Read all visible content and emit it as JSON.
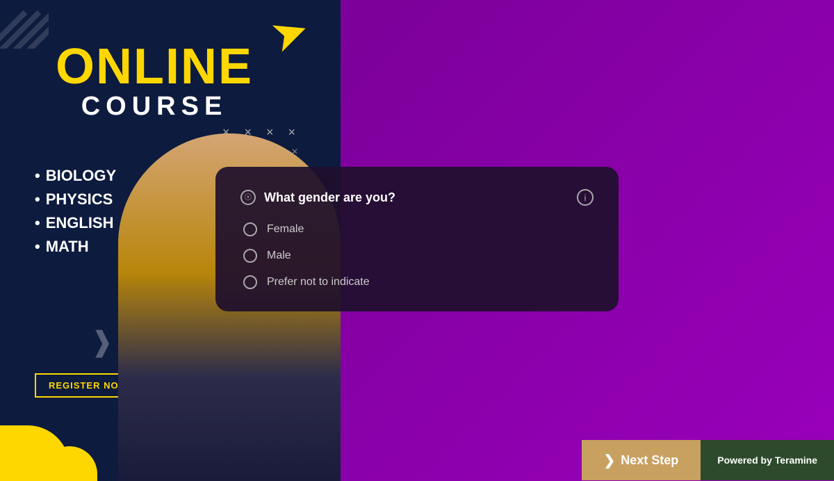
{
  "left_panel": {
    "title_line1": "ONLINE",
    "title_line2": "COURSE",
    "subjects": [
      "BIOLOGY",
      "PHYSICS",
      "ENGLISH",
      "MATH"
    ],
    "register_btn": "REGISTER NOW"
  },
  "x_pattern_1": "× × × ×",
  "x_pattern_2": "× × × ×",
  "question_card": {
    "question": "What gender are you?",
    "options": [
      {
        "label": "Female",
        "selected": false
      },
      {
        "label": "Male",
        "selected": false
      },
      {
        "label": "Prefer not to indicate",
        "selected": false
      }
    ]
  },
  "bottom": {
    "next_step_label": "Next Step",
    "powered_by_prefix": "Powered by",
    "powered_by_brand": "Teramine"
  }
}
